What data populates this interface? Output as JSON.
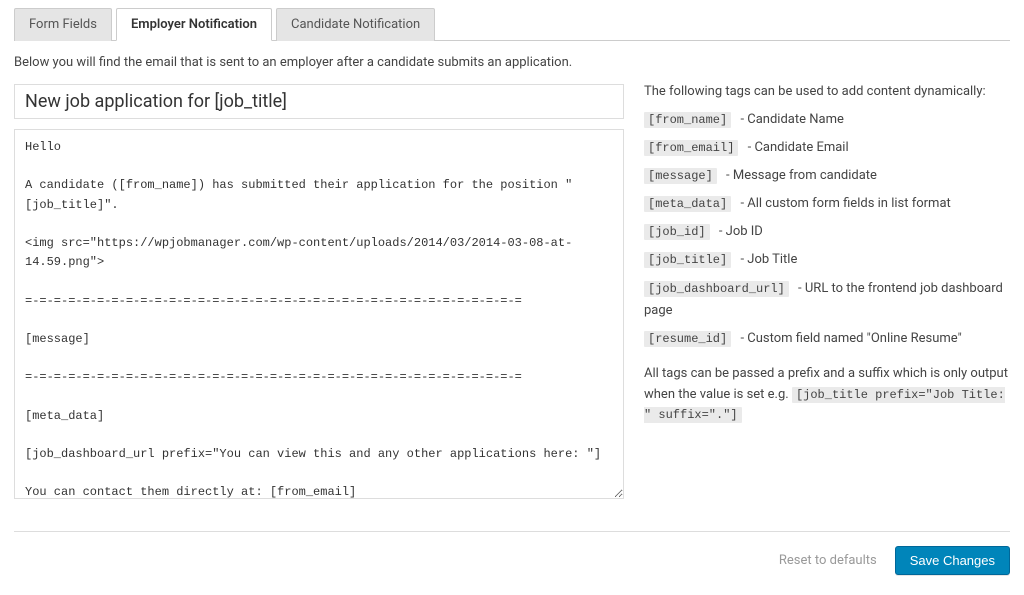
{
  "tabs": [
    {
      "label": "Form Fields",
      "active": false
    },
    {
      "label": "Employer Notification",
      "active": true
    },
    {
      "label": "Candidate Notification",
      "active": false
    }
  ],
  "intro": "Below you will find the email that is sent to an employer after a candidate submits an application.",
  "email": {
    "subject": "New job application for [job_title]",
    "body": "Hello\n\nA candidate ([from_name]) has submitted their application for the position \"[job_title]\".\n\n<img src=\"https://wpjobmanager.com/wp-content/uploads/2014/03/2014-03-08-at-14.59.png\">\n\n=-=-=-=-=-=-=-=-=-=-=-=-=-=-=-=-=-=-=-=-=-=-=-=-=-=-=-=-=-=-=-=-=-=-=\n\n[message]\n\n=-=-=-=-=-=-=-=-=-=-=-=-=-=-=-=-=-=-=-=-=-=-=-=-=-=-=-=-=-=-=-=-=-=-=\n\n[meta_data]\n\n[job_dashboard_url prefix=\"You can view this and any other applications here: \"]\n\nYou can contact them directly at: [from_email]"
  },
  "right": {
    "heading": "The following tags can be used to add content dynamically:",
    "tags": [
      {
        "code": "[from_name]",
        "desc": "Candidate Name"
      },
      {
        "code": "[from_email]",
        "desc": "Candidate Email"
      },
      {
        "code": "[message]",
        "desc": "Message from candidate"
      },
      {
        "code": "[meta_data]",
        "desc": "All custom form fields in list format"
      },
      {
        "code": "[job_id]",
        "desc": "Job ID"
      },
      {
        "code": "[job_title]",
        "desc": "Job Title"
      },
      {
        "code": "[job_dashboard_url]",
        "desc": "URL to the frontend job dashboard page"
      },
      {
        "code": "[resume_id]",
        "desc": "Custom field named \"Online Resume\""
      }
    ],
    "note_pre": "All tags can be passed a prefix and a suffix which is only output when the value is set e.g. ",
    "note_code": "[job_title prefix=\"Job Title: \" suffix=\".\"]"
  },
  "footer": {
    "reset": "Reset to defaults",
    "save": "Save Changes"
  }
}
